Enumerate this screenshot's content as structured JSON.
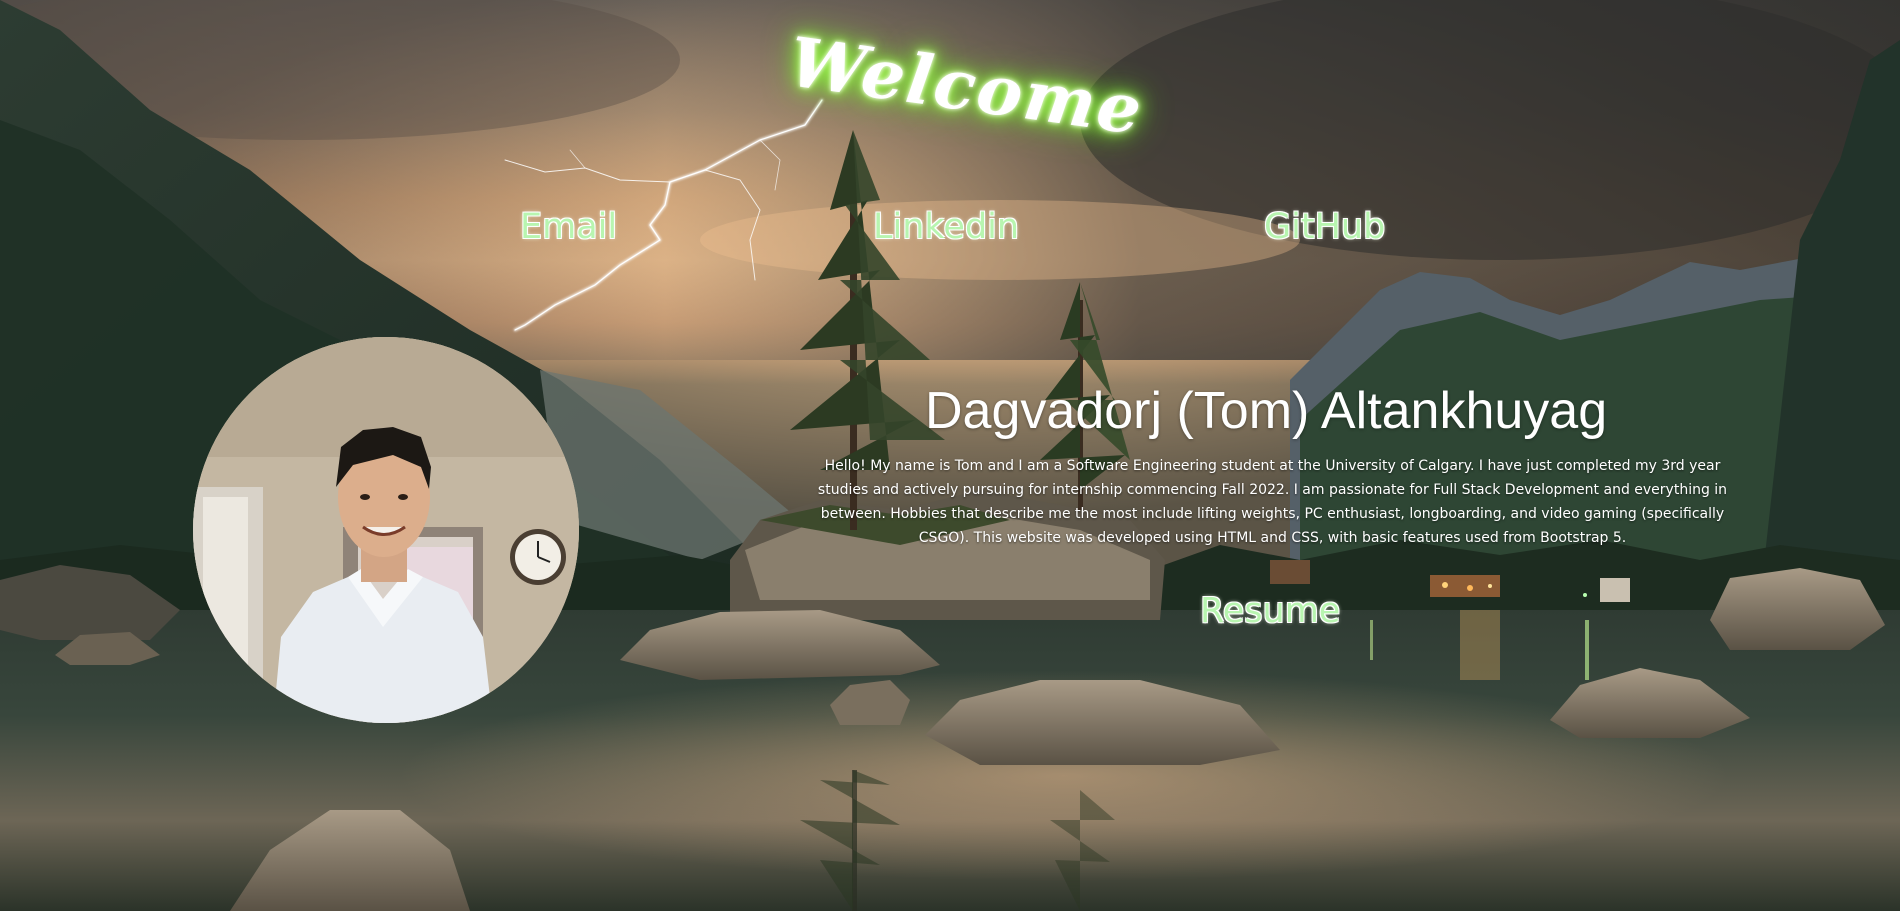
{
  "hero": {
    "welcome_text": "Welcome"
  },
  "nav": {
    "email_label": "Email",
    "linkedin_label": "Linkedin",
    "github_label": "GitHub"
  },
  "profile": {
    "name": "Dagvadorj (Tom) Altankhuyag",
    "bio": "Hello! My name is Tom and I am a Software Engineering student at the University of Calgary. I have just completed my 3rd year studies and actively pursuing for internship commencing Fall 2022. I am passionate for Full Stack Development and everything in between. Hobbies that describe me the most include lifting weights, PC enthusiast, longboarding, and video gaming (specifically CSGO). This website was developed using HTML and CSS, with basic features used from Bootstrap 5.",
    "resume_label": "Resume"
  },
  "theme": {
    "link_color": "#b8f5b0",
    "glow_color": "#8cff3a",
    "text_color": "#ffffff"
  }
}
